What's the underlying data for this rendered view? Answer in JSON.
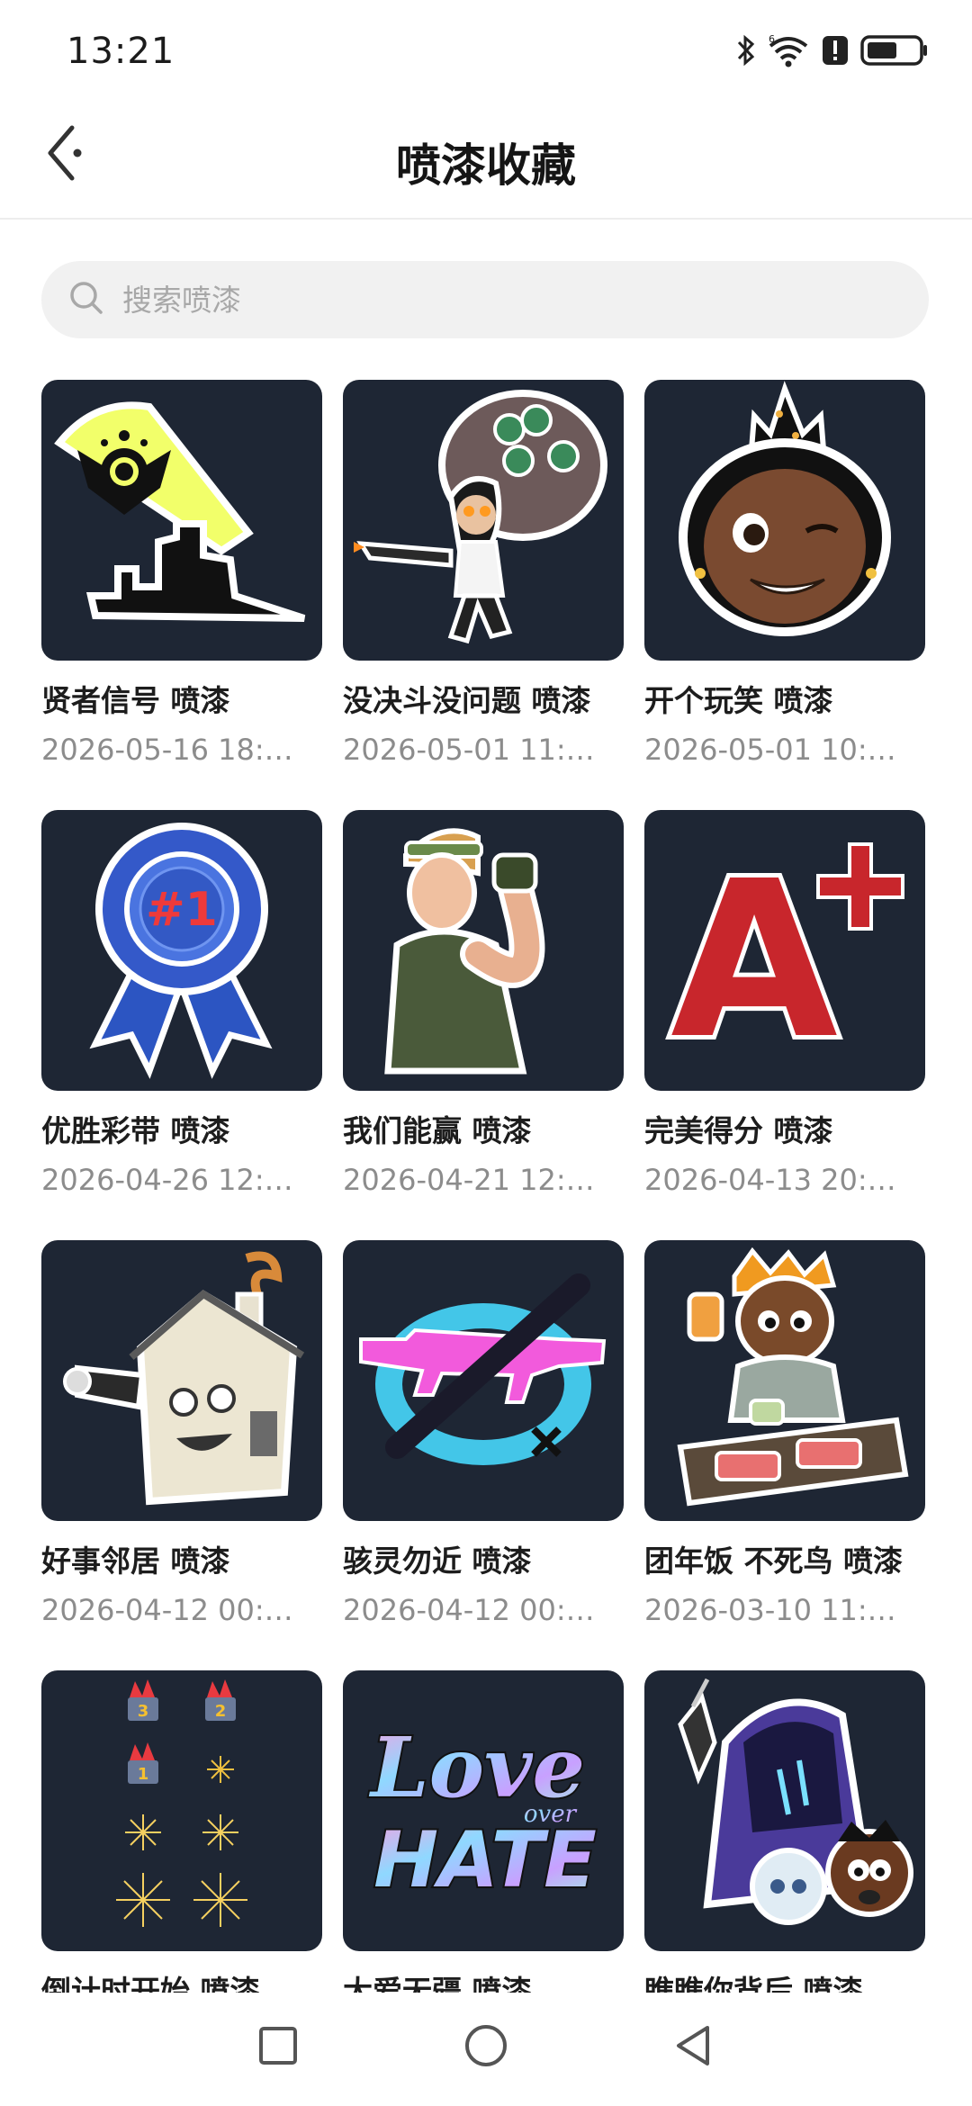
{
  "status_bar": {
    "time": "13:21",
    "icons": [
      "bluetooth-icon",
      "wifi-icon",
      "alert-icon",
      "battery-icon"
    ]
  },
  "header": {
    "title": "喷漆收藏",
    "back_icon": "back-arrow-icon"
  },
  "search": {
    "placeholder": "搜索喷漆",
    "value": ""
  },
  "items": [
    {
      "title": "贤者信号 喷漆",
      "date": "2026-05-16 18:…",
      "image": "sage-signal-spray"
    },
    {
      "title": "没决斗没问题 喷漆",
      "date": "2026-05-01 11:…",
      "image": "no-duel-no-problem-spray"
    },
    {
      "title": "开个玩笑 喷漆",
      "date": "2026-05-01 10:…",
      "image": "just-kidding-spray"
    },
    {
      "title": "优胜彩带 喷漆",
      "date": "2026-04-26 12:…",
      "image": "winner-ribbon-spray"
    },
    {
      "title": "我们能赢 喷漆",
      "date": "2026-04-21 12:…",
      "image": "we-can-win-spray"
    },
    {
      "title": "完美得分 喷漆",
      "date": "2026-04-13 20:…",
      "image": "a-plus-spray"
    },
    {
      "title": "好事邻居 喷漆",
      "date": "2026-04-12 00:…",
      "image": "nosy-neighbor-spray"
    },
    {
      "title": "骇灵勿近 喷漆",
      "date": "2026-04-12 00:…",
      "image": "no-spectre-spray"
    },
    {
      "title": "团年饭 不死鸟 喷漆",
      "date": "2026-03-10 11:…",
      "image": "reunion-dinner-phoenix-spray"
    },
    {
      "title": "倒计时开始 喷漆",
      "date": "",
      "image": "countdown-spray"
    },
    {
      "title": "大爱无疆 喷漆",
      "date": "",
      "image": "love-over-hate-spray"
    },
    {
      "title": "瞧瞧你背后 喷漆",
      "date": "",
      "image": "behind-you-spray"
    }
  ],
  "spray_art": {
    "love_line1": "Love",
    "love_line2": "over",
    "love_line3": "HATE",
    "ribbon_text": "#1",
    "grade_text": "A+",
    "countdown_3": "3",
    "countdown_2": "2",
    "countdown_1": "1"
  },
  "nav_bar": {
    "buttons": [
      "recent-apps-square-icon",
      "home-circle-icon",
      "back-triangle-icon"
    ]
  },
  "colors": {
    "thumb_background": "#1e2634",
    "search_background": "#f1f1f1",
    "date_text": "#8c8c8c"
  }
}
